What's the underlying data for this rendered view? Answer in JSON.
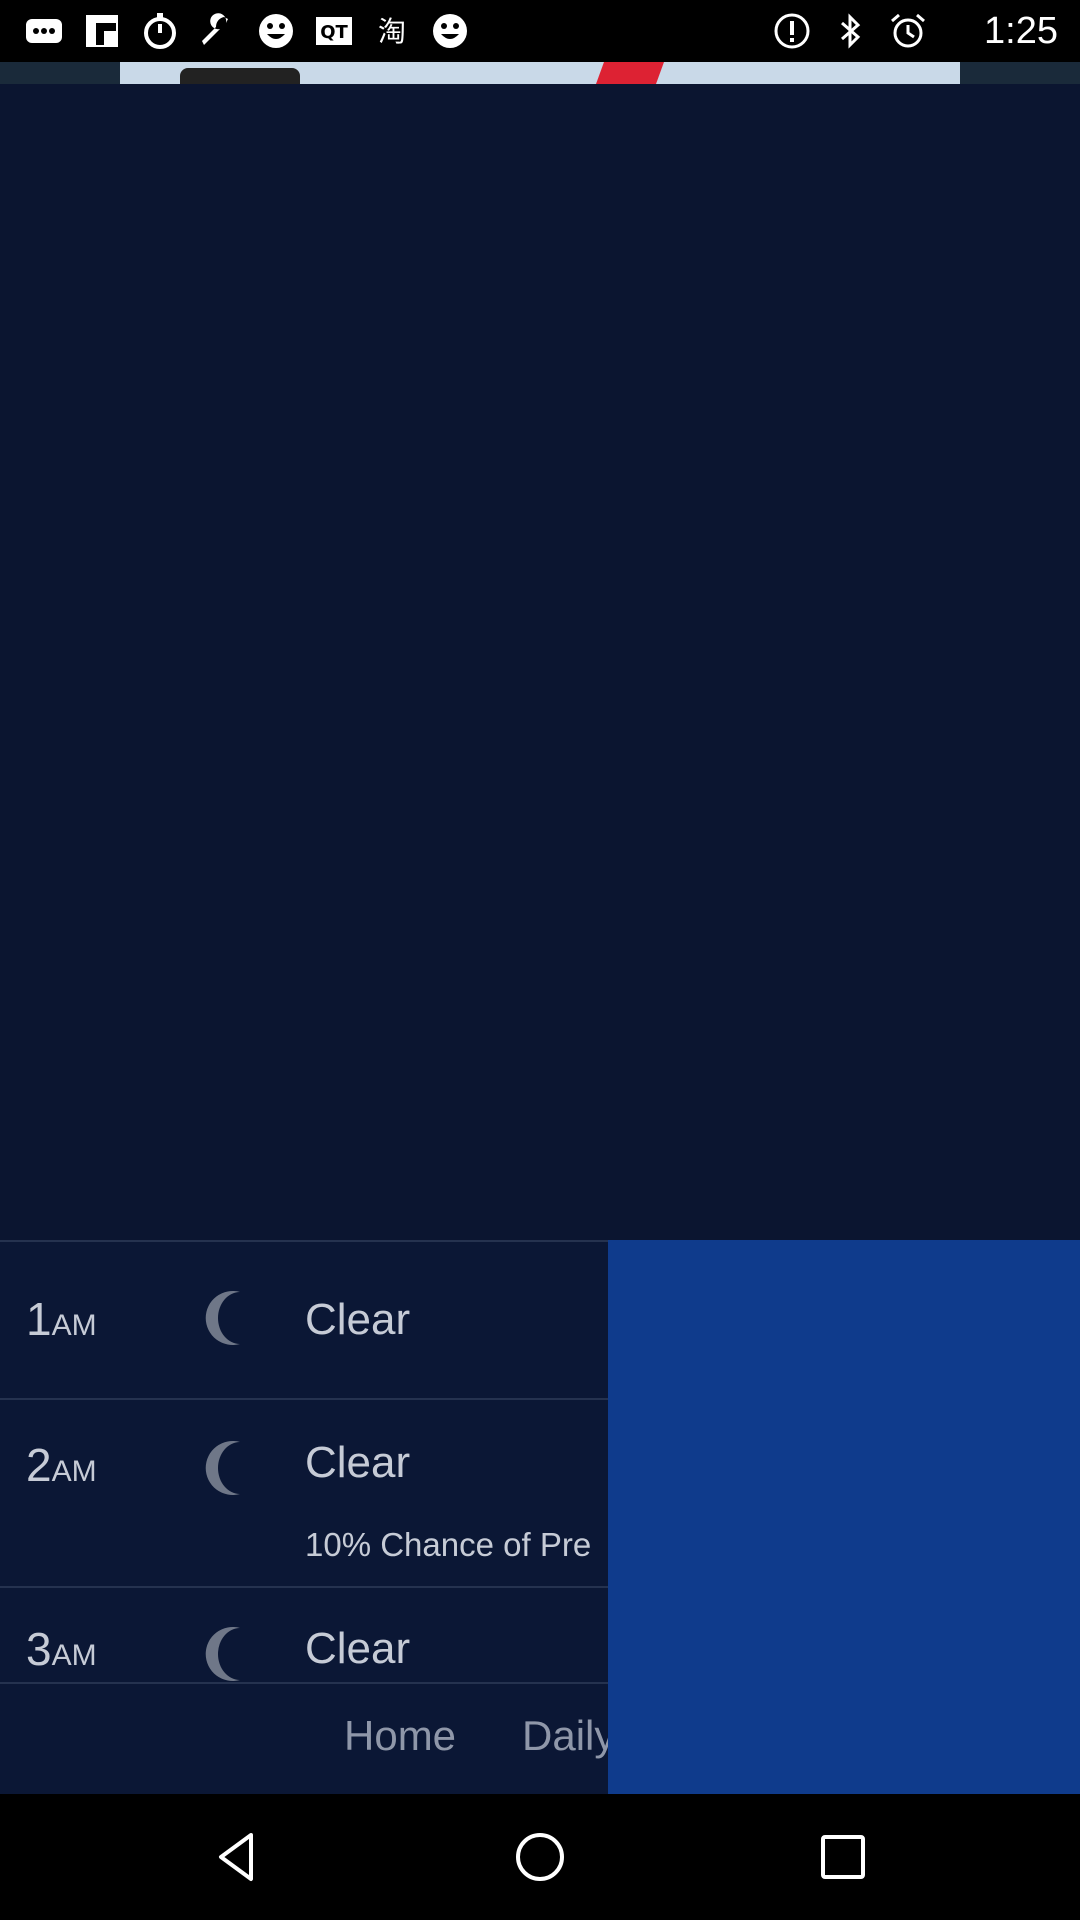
{
  "status_bar": {
    "time": "1:25",
    "left_icons": [
      "more-icon",
      "flipboard-icon",
      "timer-icon",
      "wrench-icon",
      "smiley-icon",
      "qt-icon",
      "taobao-icon",
      "smiley-icon"
    ],
    "right_icons": [
      "info-icon",
      "bluetooth-icon",
      "alarm-icon"
    ]
  },
  "hourly": [
    {
      "hour": "1",
      "ampm": "AM",
      "icon": "moon-icon",
      "condition": "Clear",
      "precip": ""
    },
    {
      "hour": "2",
      "ampm": "AM",
      "icon": "moon-icon",
      "condition": "Clear",
      "precip": "10% Chance of Pre"
    },
    {
      "hour": "3",
      "ampm": "AM",
      "icon": "moon-icon",
      "condition": "Clear",
      "precip": ""
    }
  ],
  "bottom_nav": {
    "home_label": "Home",
    "daily_label": "Daily"
  },
  "colors": {
    "background": "#0b1530",
    "overlay_blue": "#0f3b8c",
    "text": "#c6cbd6"
  }
}
